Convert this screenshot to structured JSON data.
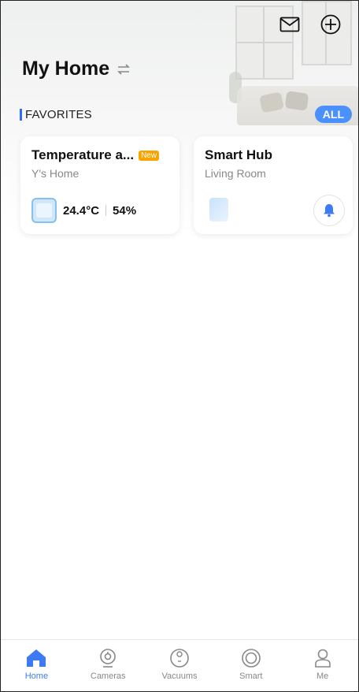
{
  "header": {
    "title": "My Home",
    "icons": [
      "envelope-icon",
      "plus-circle-icon",
      "switch-arrows-icon"
    ]
  },
  "favorites": {
    "section_label": "FAVORITES",
    "all_label": "ALL",
    "cards": [
      {
        "name": "Temperature a...",
        "badge": "New",
        "location": "Y's Home",
        "temperature": "24.4°C",
        "humidity": "54%",
        "icon": "thermometer-hygrometer-icon"
      },
      {
        "name": "Smart Hub",
        "location": "Living Room",
        "icon": "hub-device-icon",
        "action_icon": "bell-icon"
      }
    ]
  },
  "tabbar": {
    "items": [
      {
        "label": "Home",
        "icon": "home-icon",
        "active": true
      },
      {
        "label": "Cameras",
        "icon": "camera-icon",
        "active": false
      },
      {
        "label": "Vacuums",
        "icon": "vacuum-icon",
        "active": false
      },
      {
        "label": "Smart",
        "icon": "smart-icon",
        "active": false
      },
      {
        "label": "Me",
        "icon": "person-icon",
        "active": false
      }
    ]
  },
  "colors": {
    "accent": "#3d7bf5",
    "all_button": "#4a90ff",
    "badge": "#f7a400",
    "inactive": "#888888"
  }
}
